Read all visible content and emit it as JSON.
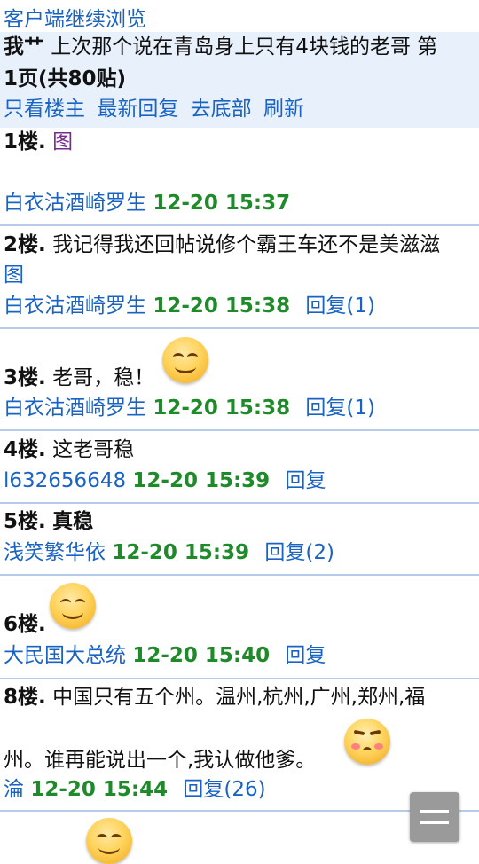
{
  "topbar": {
    "title": "客户端继续浏览"
  },
  "thread": {
    "title_prefix": "我艹",
    "title_text": " 上次那个说在青岛身上只有4块钱的老哥 第",
    "page_info": "1页(共80贴)",
    "nav": [
      "只看楼主",
      "最新回复",
      "去底部",
      "刷新"
    ]
  },
  "posts": [
    {
      "floor": "1楼.",
      "content": "图",
      "content_type": "image-link",
      "author": "白衣沽酒崎罗生",
      "time": "12-20 15:37",
      "reply": ""
    },
    {
      "floor": "2楼.",
      "content": "我记得我还回帖说修个霸王车还不是美滋滋",
      "content2": "图",
      "author": "白衣沽酒崎罗生",
      "time": "12-20 15:38",
      "reply": "回复(1)"
    },
    {
      "floor": "3楼.",
      "content": "老哥，稳！",
      "emoji": "smile-icon",
      "author": "白衣沽酒崎罗生",
      "time": "12-20 15:38",
      "reply": "回复(1)"
    },
    {
      "floor": "4楼.",
      "content": "这老哥稳",
      "author": "l632656648",
      "time": "12-20 15:39",
      "reply": "回复"
    },
    {
      "floor": "5楼.",
      "content": "真稳",
      "author": "浅笑繁华依",
      "time": "12-20 15:39",
      "reply": "回复(2)"
    },
    {
      "floor": "6楼.",
      "content": "",
      "emoji": "smile-icon",
      "author": "大民国大总统",
      "time": "12-20 15:40",
      "reply": "回复"
    },
    {
      "floor": "8楼.",
      "content": "中国只有五个州。温州,杭州,广州,郑州,福",
      "content2": "州。谁再能说出一个,我认做他爹。",
      "emoji": "blush-icon",
      "author": "淪",
      "time": "12-20 15:44",
      "reply": "回复(26)"
    }
  ],
  "colors": {
    "link": "#1a63c2",
    "time": "#1f8a2a",
    "header_bg": "#e8f1fb",
    "separator": "#b6cbe8"
  },
  "fab": {
    "icon": "menu-icon"
  }
}
